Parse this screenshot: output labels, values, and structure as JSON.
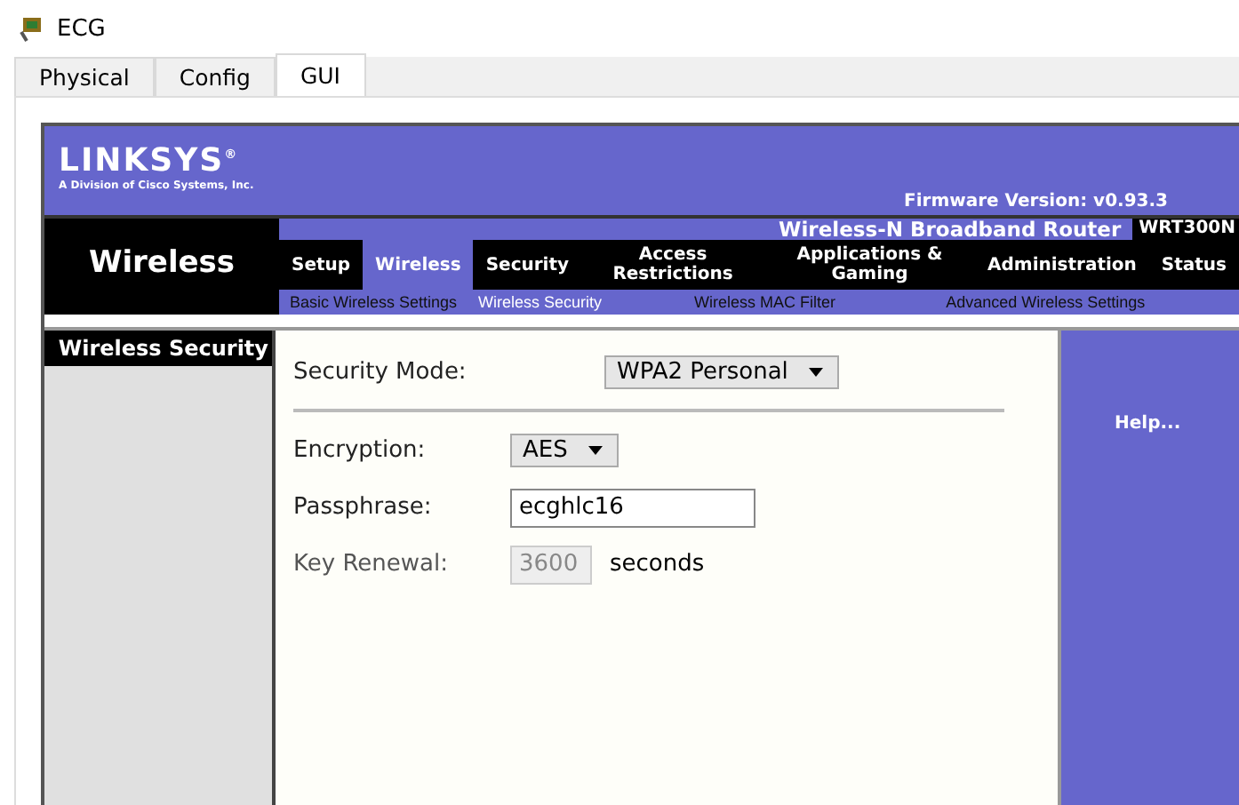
{
  "window": {
    "title": "ECG"
  },
  "tabs": [
    {
      "label": "Physical",
      "selected": false
    },
    {
      "label": "Config",
      "selected": false
    },
    {
      "label": "GUI",
      "selected": true
    }
  ],
  "router": {
    "logo": "LINKSYS",
    "registered": "®",
    "tagline": "A Division of Cisco Systems, Inc.",
    "firmware": "Firmware Version: v0.93.3",
    "product": "Wireless-N Broadband Router",
    "model": "WRT300N",
    "section": "Wireless",
    "nav": [
      {
        "label": "Setup",
        "selected": false
      },
      {
        "label": "Wireless",
        "selected": true
      },
      {
        "label": "Security",
        "selected": false
      },
      {
        "label": "Access Restrictions",
        "selected": false
      },
      {
        "label": "Applications & Gaming",
        "selected": false
      },
      {
        "label": "Administration",
        "selected": false
      },
      {
        "label": "Status",
        "selected": false
      }
    ],
    "subnav": [
      {
        "label": "Basic Wireless Settings",
        "selected": false
      },
      {
        "label": "Wireless Security",
        "selected": true
      },
      {
        "label": "Wireless MAC Filter",
        "selected": false
      },
      {
        "label": "Advanced Wireless Settings",
        "selected": false
      }
    ],
    "side_title": "Wireless Security",
    "security_mode": {
      "label": "Security Mode:",
      "value": "WPA2 Personal"
    },
    "fields": [
      {
        "kind": "select",
        "label": "Encryption:",
        "value": "AES",
        "disabled": false
      },
      {
        "kind": "text",
        "label": "Passphrase:",
        "value": "ecghlc16",
        "disabled": false
      },
      {
        "kind": "text",
        "label": "Key Renewal:",
        "value": "3600",
        "unit": "seconds",
        "disabled": true
      }
    ],
    "help": "Help..."
  }
}
